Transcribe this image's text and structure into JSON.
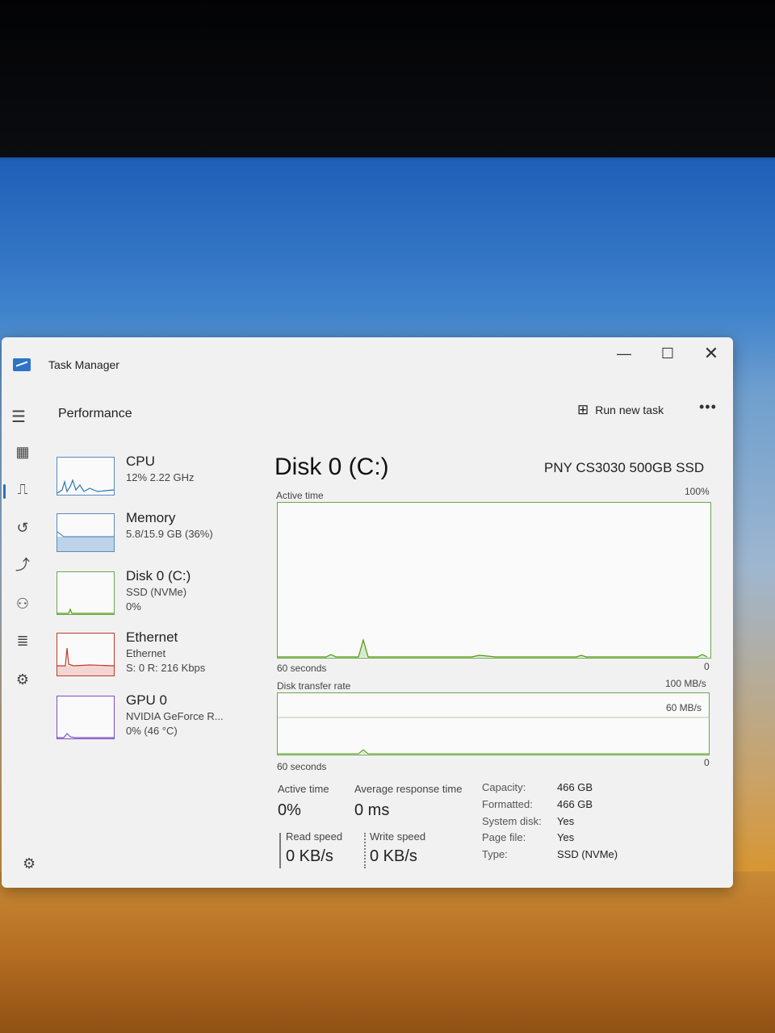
{
  "window": {
    "title": "Task Manager",
    "minimize": "—",
    "maximize": "☐",
    "close": "✕"
  },
  "header": {
    "section": "Performance",
    "run_new_task": "Run new task",
    "more": "•••"
  },
  "sidebar": {
    "items": [
      "menu-icon",
      "processes-icon",
      "performance-icon",
      "app-history-icon",
      "startup-icon",
      "users-icon",
      "details-icon",
      "services-icon"
    ],
    "settings": "settings-icon"
  },
  "devices": [
    {
      "name": "CPU",
      "line1": "12% 2.22 GHz",
      "line2": "",
      "color": "#2e74b5"
    },
    {
      "name": "Memory",
      "line1": "5.8/15.9 GB (36%)",
      "line2": "",
      "color": "#5a8bbd"
    },
    {
      "name": "Disk 0 (C:)",
      "line1": "SSD (NVMe)",
      "line2": "0%",
      "color": "#4e9a06"
    },
    {
      "name": "Ethernet",
      "line1": "Ethernet",
      "line2": "S: 0 R: 216 Kbps",
      "color": "#c0392b"
    },
    {
      "name": "GPU 0",
      "line1": "NVIDIA GeForce R...",
      "line2": "0% (46 °C)",
      "color": "#7b4fc4"
    }
  ],
  "detail": {
    "title": "Disk 0 (C:)",
    "model": "PNY CS3030 500GB SSD",
    "active_time_label": "Active time",
    "active_time_max": "100%",
    "time_axis": "60 seconds",
    "zero": "0",
    "transfer_label": "Disk transfer rate",
    "transfer_max": "100 MB/s",
    "transfer_mid": "60 MB/s",
    "stats": {
      "active_time_label": "Active time",
      "active_time_value": "0%",
      "response_label": "Average response time",
      "response_value": "0 ms",
      "read_label": "Read speed",
      "read_value": "0 KB/s",
      "write_label": "Write speed",
      "write_value": "0 KB/s"
    },
    "properties": [
      {
        "label": "Capacity:",
        "value": "466 GB"
      },
      {
        "label": "Formatted:",
        "value": "466 GB"
      },
      {
        "label": "System disk:",
        "value": "Yes"
      },
      {
        "label": "Page file:",
        "value": "Yes"
      },
      {
        "label": "Type:",
        "value": "SSD (NVMe)"
      }
    ]
  }
}
